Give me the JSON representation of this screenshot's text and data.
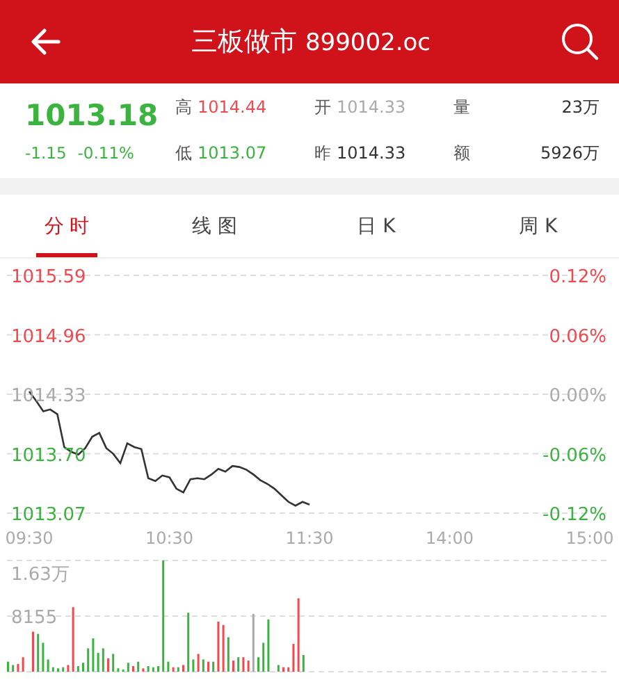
{
  "header": {
    "title": "三板做市",
    "code": "899002.oc"
  },
  "quote": {
    "price": "1013.18",
    "change": "-1.15",
    "change_pct": "-0.11%",
    "color": "#3bb33f",
    "stats": [
      {
        "label": "高",
        "value": "1014.44",
        "color": "#f0494f"
      },
      {
        "label": "开",
        "value": "1014.33",
        "color": "#aaaaaa"
      },
      {
        "label": "量",
        "value": "23万",
        "color": "#333333"
      },
      {
        "label": "低",
        "value": "1013.07",
        "color": "#3bb33f"
      },
      {
        "label": "昨",
        "value": "1014.33",
        "color": "#333333"
      },
      {
        "label": "额",
        "value": "5926万",
        "color": "#333333"
      }
    ]
  },
  "tabs": [
    {
      "label": "分 时",
      "selected": true
    },
    {
      "label": "线 图",
      "selected": false
    },
    {
      "label": "日 K",
      "selected": false
    },
    {
      "label": "周 K",
      "selected": false
    }
  ],
  "price_chart": {
    "chart_data": {
      "type": "line",
      "grid": true,
      "ylim": [
        1013.07,
        1015.59
      ],
      "yticks": [
        {
          "value": 1015.59,
          "label": "1015.59"
        },
        {
          "value": 1014.96,
          "label": "1014.96"
        },
        {
          "value": 1014.33,
          "label": "1014.33"
        },
        {
          "value": 1013.7,
          "label": "1013.70"
        },
        {
          "value": 1013.07,
          "label": "1013.07"
        }
      ],
      "categories": [
        "09:30",
        null,
        null,
        null,
        null,
        null,
        null,
        null,
        null,
        null,
        null,
        null,
        null,
        null,
        null,
        null,
        null,
        null,
        null,
        null,
        "10:30",
        null,
        null,
        null,
        null,
        null,
        null,
        null,
        null,
        null,
        null,
        null,
        null,
        null,
        null,
        null,
        null,
        null,
        null,
        null,
        "11:30",
        null,
        null,
        null,
        null,
        null,
        null,
        null,
        null,
        null,
        null,
        null,
        null,
        null,
        null,
        null,
        null,
        null,
        null,
        null,
        "14:00",
        null,
        null,
        null,
        null,
        null,
        null,
        null,
        null,
        null,
        null,
        null,
        null,
        null,
        null,
        null,
        null,
        null,
        null,
        null,
        "15:00"
      ],
      "series": [
        {
          "color": "#333333",
          "values": [
            1014.36,
            1014.26,
            1014.15,
            1014.17,
            1014.12,
            1013.77,
            1013.72,
            1013.69,
            1013.76,
            1013.88,
            1013.92,
            1013.76,
            1013.7,
            1013.6,
            1013.81,
            1013.77,
            1013.75,
            1013.44,
            1013.41,
            1013.47,
            1013.45,
            1013.33,
            1013.29,
            1013.43,
            1013.44,
            1013.43,
            1013.48,
            1013.54,
            1013.51,
            1013.57,
            1013.56,
            1013.53,
            1013.48,
            1013.42,
            1013.38,
            1013.33,
            1013.26,
            1013.19,
            1013.15,
            1013.19,
            1013.16,
            null,
            null,
            null,
            null,
            null,
            null,
            null,
            null,
            null,
            null,
            null,
            null,
            null,
            null,
            null,
            null,
            null,
            null,
            null,
            null,
            null,
            null,
            null,
            null,
            null,
            null,
            null,
            null,
            null,
            null,
            null,
            null,
            null,
            null,
            null,
            null,
            null,
            null,
            null,
            null
          ]
        }
      ]
    },
    "right_labels": [
      {
        "label": "0.12%",
        "color": "#f0494f"
      },
      {
        "label": "0.06%",
        "color": "#f0494f"
      },
      {
        "label": "0.00%",
        "color": "#aaaaaa"
      },
      {
        "label": "-0.06%",
        "color": "#3bb33f"
      },
      {
        "label": "-0.12%",
        "color": "#3bb33f"
      }
    ]
  },
  "volume_chart": {
    "axis_labels": [
      "1.63万",
      "8155"
    ]
  }
}
